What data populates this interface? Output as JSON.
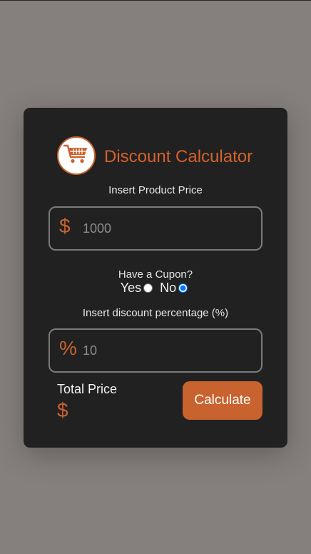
{
  "app": {
    "title": "Discount Calculator",
    "logo_icon": "shopping-cart-icon",
    "accent_color": "#c8622f"
  },
  "price": {
    "label": "Insert Product Price",
    "symbol": "$",
    "placeholder": "1000",
    "value": ""
  },
  "coupon": {
    "question": "Have a Cupon?",
    "yes_label": "Yes",
    "no_label": "No",
    "selected": "No"
  },
  "discount": {
    "label": "Insert discount percentage (%)",
    "symbol": "%",
    "placeholder": "10",
    "value": ""
  },
  "total": {
    "label": "Total Price",
    "symbol": "$",
    "value": ""
  },
  "actions": {
    "calculate_label": "Calculate"
  }
}
